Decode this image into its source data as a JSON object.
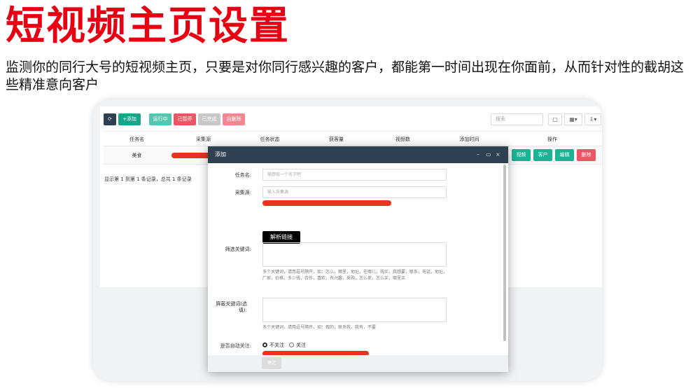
{
  "promo": {
    "title": "短视频主页设置",
    "description": "监测你的同行大号的短视频主页，只要是对你同行感兴趣的客户，都能第一时间出现在你面前，从而针对性的截胡这些精准意向客户"
  },
  "colors": {
    "accent_red": "#e60012",
    "redaction": "#e8341c",
    "header_dark": "#2f4050",
    "green": "#1ab394",
    "red": "#ed5565"
  },
  "toolbar": {
    "refresh_icon": "refresh-icon",
    "add_label": "+添加",
    "running_label": "运行中",
    "paused_label": "已暂停",
    "done_label": "已完成",
    "delete_label": "自删除",
    "search_placeholder": "搜索",
    "view_toggle": "▢",
    "columns_toggle": "▦▾",
    "export_toggle": "⇩▾"
  },
  "table": {
    "columns": [
      "任务名",
      "采集源",
      "任务状态",
      "获客量",
      "视频数",
      "添加时间",
      "操作"
    ],
    "rows": [
      {
        "name": "美食",
        "actions": [
          "视频",
          "客户",
          "编辑",
          "删除"
        ]
      }
    ],
    "footer": "显示第 1 到第 1 条记录，总共 1 条记录"
  },
  "modal": {
    "title": "添加",
    "controls": [
      "–",
      "▭",
      "×"
    ],
    "task_name_label": "任务名:",
    "task_name_placeholder": "随意取一个名字吧",
    "source_label": "采集源:",
    "source_placeholder": "输入采集源",
    "parse_button": "解析链接",
    "filter_keywords_label": "筛选关键词:",
    "filter_keywords_hint": "多个关键词，请用逗号隔开，如：怎么，哪里，地址，在哪儿，购买，我想要，联系，电话，地址，厂家，价格，多少钱，合作，喜欢，有兴趣，采购，怎么卖，怎么买，哪里买",
    "block_keywords_label": "屏蔽关键词(选填):",
    "block_keywords_hint": "多个关键词，请用逗号隔开，如：假的，联系我，我有，不要",
    "auto_follow_label": "是否自动关注:",
    "auto_follow_options": [
      "不关注",
      "关注"
    ],
    "auto_follow_selected": "不关注",
    "confirm_button": "确定"
  }
}
